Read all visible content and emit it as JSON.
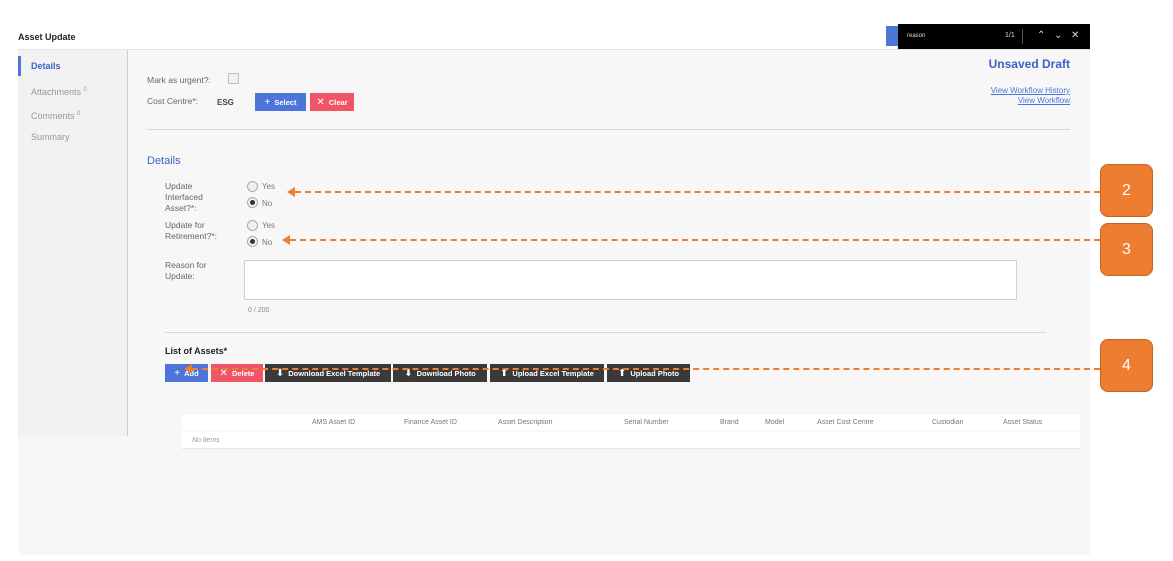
{
  "app": {
    "title": "Asset Update"
  },
  "findbar": {
    "query": "reason",
    "count": "1/1"
  },
  "sidebar": {
    "items": [
      {
        "label": "Details",
        "badge": ""
      },
      {
        "label": "Attachments",
        "badge": "0"
      },
      {
        "label": "Comments",
        "badge": "0"
      },
      {
        "label": "Summary",
        "badge": ""
      }
    ]
  },
  "header": {
    "urgent_label": "Mark as urgent?:",
    "cost_centre_label": "Cost Centre*:",
    "cost_centre_value": "ESG",
    "select_label": "Select",
    "clear_label": "Clear",
    "status": "Unsaved Draft",
    "workflow_history_link": "View Workflow History",
    "workflow_link": "View Workflow"
  },
  "details": {
    "title": "Details",
    "interfaced_label": "Update Interfaced Asset?*:",
    "interfaced_yes": "Yes",
    "interfaced_no": "No",
    "interfaced_selected": "No",
    "retirement_label": "Update for Retirement?*:",
    "retirement_yes": "Yes",
    "retirement_no": "No",
    "retirement_selected": "No",
    "reason_label": "Reason for Update:",
    "reason_value": "",
    "reason_counter": "0 / 200"
  },
  "assets": {
    "title": "List of Assets*",
    "buttons": {
      "add": "Add",
      "delete": "Delete",
      "download_template": "Download Excel Template",
      "download_photo": "Download Photo",
      "upload_template": "Upload Excel Template",
      "upload_photo": "Upload Photo"
    },
    "columns": [
      "AMS Asset ID",
      "Finance Asset ID",
      "Asset Description",
      "Serial Number",
      "Brand",
      "Model",
      "Asset Cost Centre",
      "Custodian",
      "Asset Status"
    ],
    "empty_text": "No items"
  },
  "callouts": [
    "2",
    "3",
    "4"
  ],
  "colors": {
    "accent": "#4c74d9",
    "danger": "#ef5566",
    "dark_button": "#3a3a3a",
    "callout": "#ed7d31"
  }
}
